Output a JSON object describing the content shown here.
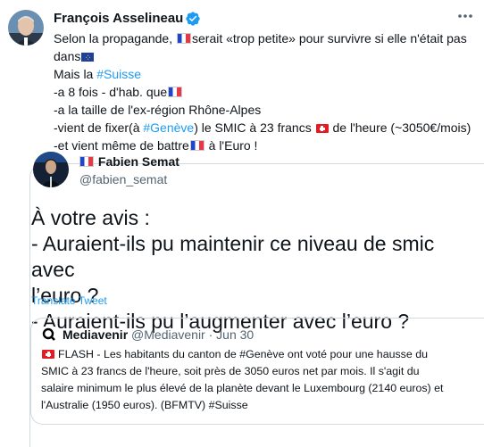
{
  "tweet": {
    "author_name": "François Asselineau",
    "lines": {
      "l1_a": "Selon la propagande,",
      "l1_b": "serait «trop petite» pour survivre si elle n'était pas",
      "l2": "dans",
      "l3_a": "Mais la",
      "l3_hashtag": "#Suisse",
      "l4_a": "-a 8 fois - d'hab. que",
      "l5": "-a la taille de l'ex-région Rhône-Alpes",
      "l6_a": "-vient de fixer(à",
      "l6_hashtag": "#Genève",
      "l6_b": ") le SMIC à 23 francs",
      "l6_c": "de l'heure (~3050€/mois)",
      "l7_a": "-et vient même de battre",
      "l7_b": "à l'Euro !"
    }
  },
  "quoted": {
    "author_name": "Fabien Semat",
    "handle": "@fabien_semat",
    "text_lines": [
      "À votre avis :",
      "- Auraient-ils pu maintenir ce niveau de smic avec",
      "l’euro ?",
      "- Auraient-ils pu l’augmenter avec l’euro ?"
    ],
    "translate_label": "Translate Tweet"
  },
  "inner_quote": {
    "author_name": "Mediavenir",
    "handle": "@Mediavenir",
    "separator": "·",
    "date": "Jun 30",
    "text_lines": [
      "FLASH - Les habitants du canton de #Genève ont voté pour une hausse du",
      "SMIC à 23 francs de l'heure, soit près de 3050 euros net par mois. Il s'agit du",
      "salaire minimum le plus élevé de la planète devant le Luxembourg (2140 euros) et",
      "l'Australie (1950 euros). (BFMTV) #Suisse"
    ]
  },
  "colors": {
    "link": "#1d9bf0",
    "verified": "#1d9bf0",
    "border": "#cfd9de",
    "muted": "#536471"
  },
  "icons": {
    "verified": "verified-badge-icon",
    "more": "more-icon",
    "flag_fr": "flag-france-icon",
    "flag_ch": "flag-switzerland-icon",
    "flag_eu": "flag-eu-icon"
  }
}
